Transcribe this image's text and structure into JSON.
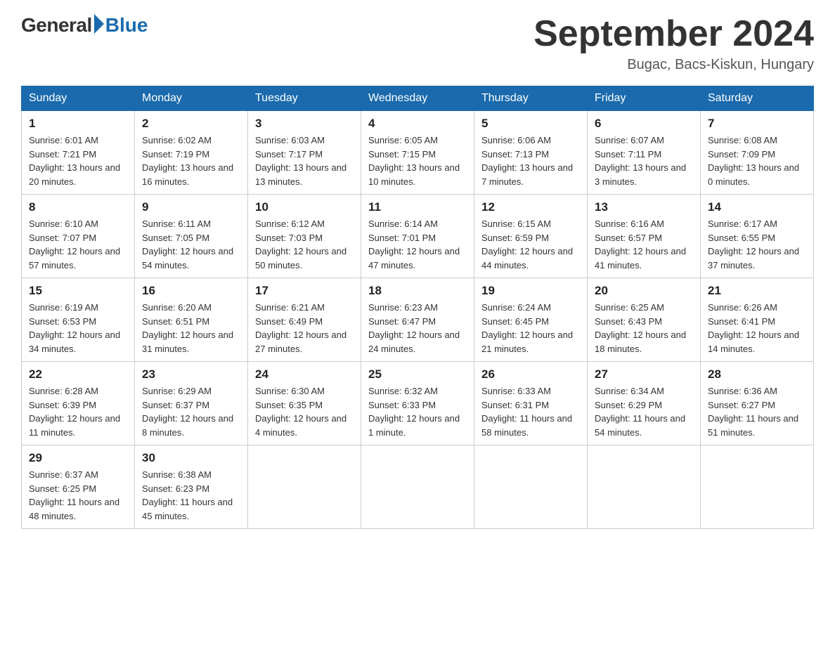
{
  "logo": {
    "general": "General",
    "blue": "Blue"
  },
  "title": "September 2024",
  "location": "Bugac, Bacs-Kiskun, Hungary",
  "days_of_week": [
    "Sunday",
    "Monday",
    "Tuesday",
    "Wednesday",
    "Thursday",
    "Friday",
    "Saturday"
  ],
  "weeks": [
    [
      {
        "day": "1",
        "sunrise": "Sunrise: 6:01 AM",
        "sunset": "Sunset: 7:21 PM",
        "daylight": "Daylight: 13 hours and 20 minutes."
      },
      {
        "day": "2",
        "sunrise": "Sunrise: 6:02 AM",
        "sunset": "Sunset: 7:19 PM",
        "daylight": "Daylight: 13 hours and 16 minutes."
      },
      {
        "day": "3",
        "sunrise": "Sunrise: 6:03 AM",
        "sunset": "Sunset: 7:17 PM",
        "daylight": "Daylight: 13 hours and 13 minutes."
      },
      {
        "day": "4",
        "sunrise": "Sunrise: 6:05 AM",
        "sunset": "Sunset: 7:15 PM",
        "daylight": "Daylight: 13 hours and 10 minutes."
      },
      {
        "day": "5",
        "sunrise": "Sunrise: 6:06 AM",
        "sunset": "Sunset: 7:13 PM",
        "daylight": "Daylight: 13 hours and 7 minutes."
      },
      {
        "day": "6",
        "sunrise": "Sunrise: 6:07 AM",
        "sunset": "Sunset: 7:11 PM",
        "daylight": "Daylight: 13 hours and 3 minutes."
      },
      {
        "day": "7",
        "sunrise": "Sunrise: 6:08 AM",
        "sunset": "Sunset: 7:09 PM",
        "daylight": "Daylight: 13 hours and 0 minutes."
      }
    ],
    [
      {
        "day": "8",
        "sunrise": "Sunrise: 6:10 AM",
        "sunset": "Sunset: 7:07 PM",
        "daylight": "Daylight: 12 hours and 57 minutes."
      },
      {
        "day": "9",
        "sunrise": "Sunrise: 6:11 AM",
        "sunset": "Sunset: 7:05 PM",
        "daylight": "Daylight: 12 hours and 54 minutes."
      },
      {
        "day": "10",
        "sunrise": "Sunrise: 6:12 AM",
        "sunset": "Sunset: 7:03 PM",
        "daylight": "Daylight: 12 hours and 50 minutes."
      },
      {
        "day": "11",
        "sunrise": "Sunrise: 6:14 AM",
        "sunset": "Sunset: 7:01 PM",
        "daylight": "Daylight: 12 hours and 47 minutes."
      },
      {
        "day": "12",
        "sunrise": "Sunrise: 6:15 AM",
        "sunset": "Sunset: 6:59 PM",
        "daylight": "Daylight: 12 hours and 44 minutes."
      },
      {
        "day": "13",
        "sunrise": "Sunrise: 6:16 AM",
        "sunset": "Sunset: 6:57 PM",
        "daylight": "Daylight: 12 hours and 41 minutes."
      },
      {
        "day": "14",
        "sunrise": "Sunrise: 6:17 AM",
        "sunset": "Sunset: 6:55 PM",
        "daylight": "Daylight: 12 hours and 37 minutes."
      }
    ],
    [
      {
        "day": "15",
        "sunrise": "Sunrise: 6:19 AM",
        "sunset": "Sunset: 6:53 PM",
        "daylight": "Daylight: 12 hours and 34 minutes."
      },
      {
        "day": "16",
        "sunrise": "Sunrise: 6:20 AM",
        "sunset": "Sunset: 6:51 PM",
        "daylight": "Daylight: 12 hours and 31 minutes."
      },
      {
        "day": "17",
        "sunrise": "Sunrise: 6:21 AM",
        "sunset": "Sunset: 6:49 PM",
        "daylight": "Daylight: 12 hours and 27 minutes."
      },
      {
        "day": "18",
        "sunrise": "Sunrise: 6:23 AM",
        "sunset": "Sunset: 6:47 PM",
        "daylight": "Daylight: 12 hours and 24 minutes."
      },
      {
        "day": "19",
        "sunrise": "Sunrise: 6:24 AM",
        "sunset": "Sunset: 6:45 PM",
        "daylight": "Daylight: 12 hours and 21 minutes."
      },
      {
        "day": "20",
        "sunrise": "Sunrise: 6:25 AM",
        "sunset": "Sunset: 6:43 PM",
        "daylight": "Daylight: 12 hours and 18 minutes."
      },
      {
        "day": "21",
        "sunrise": "Sunrise: 6:26 AM",
        "sunset": "Sunset: 6:41 PM",
        "daylight": "Daylight: 12 hours and 14 minutes."
      }
    ],
    [
      {
        "day": "22",
        "sunrise": "Sunrise: 6:28 AM",
        "sunset": "Sunset: 6:39 PM",
        "daylight": "Daylight: 12 hours and 11 minutes."
      },
      {
        "day": "23",
        "sunrise": "Sunrise: 6:29 AM",
        "sunset": "Sunset: 6:37 PM",
        "daylight": "Daylight: 12 hours and 8 minutes."
      },
      {
        "day": "24",
        "sunrise": "Sunrise: 6:30 AM",
        "sunset": "Sunset: 6:35 PM",
        "daylight": "Daylight: 12 hours and 4 minutes."
      },
      {
        "day": "25",
        "sunrise": "Sunrise: 6:32 AM",
        "sunset": "Sunset: 6:33 PM",
        "daylight": "Daylight: 12 hours and 1 minute."
      },
      {
        "day": "26",
        "sunrise": "Sunrise: 6:33 AM",
        "sunset": "Sunset: 6:31 PM",
        "daylight": "Daylight: 11 hours and 58 minutes."
      },
      {
        "day": "27",
        "sunrise": "Sunrise: 6:34 AM",
        "sunset": "Sunset: 6:29 PM",
        "daylight": "Daylight: 11 hours and 54 minutes."
      },
      {
        "day": "28",
        "sunrise": "Sunrise: 6:36 AM",
        "sunset": "Sunset: 6:27 PM",
        "daylight": "Daylight: 11 hours and 51 minutes."
      }
    ],
    [
      {
        "day": "29",
        "sunrise": "Sunrise: 6:37 AM",
        "sunset": "Sunset: 6:25 PM",
        "daylight": "Daylight: 11 hours and 48 minutes."
      },
      {
        "day": "30",
        "sunrise": "Sunrise: 6:38 AM",
        "sunset": "Sunset: 6:23 PM",
        "daylight": "Daylight: 11 hours and 45 minutes."
      },
      null,
      null,
      null,
      null,
      null
    ]
  ]
}
